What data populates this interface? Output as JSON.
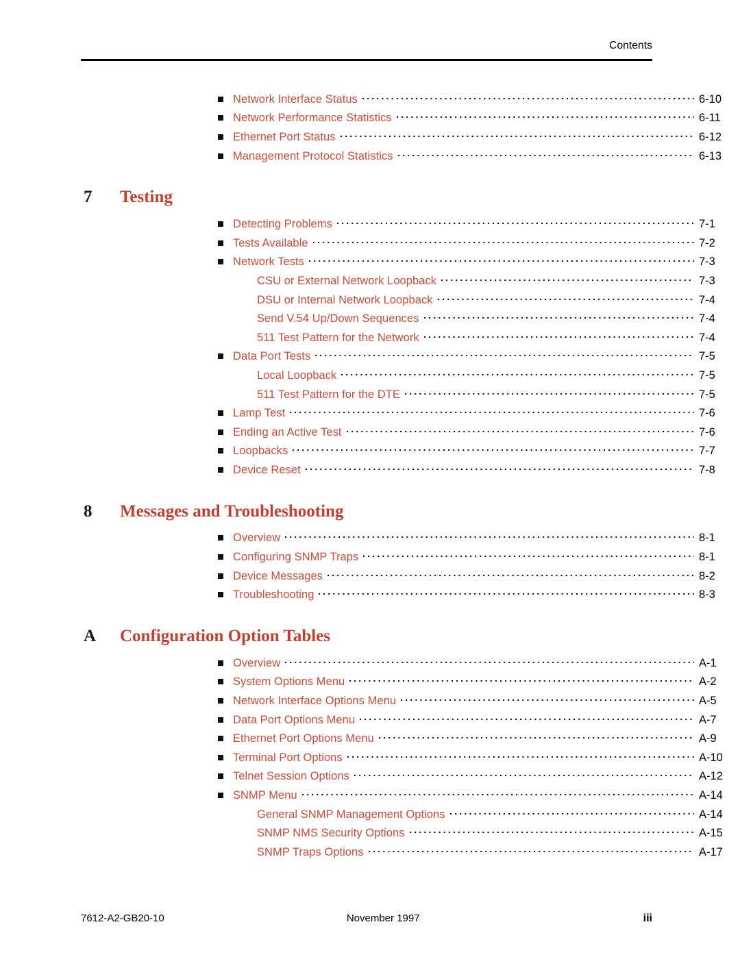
{
  "header": {
    "label": "Contents"
  },
  "toc": {
    "groups": [
      {
        "heading": null,
        "entries": [
          {
            "level": 1,
            "title": "Network Interface Status",
            "page": "6-10"
          },
          {
            "level": 1,
            "title": "Network Performance Statistics",
            "page": "6-11"
          },
          {
            "level": 1,
            "title": "Ethernet Port Status",
            "page": "6-12"
          },
          {
            "level": 1,
            "title": "Management Protocol Statistics",
            "page": "6-13"
          }
        ]
      },
      {
        "heading": {
          "number": "7",
          "title": "Testing"
        },
        "entries": [
          {
            "level": 1,
            "title": "Detecting Problems",
            "page": "7-1"
          },
          {
            "level": 1,
            "title": "Tests Available",
            "page": "7-2"
          },
          {
            "level": 1,
            "title": "Network Tests",
            "page": "7-3"
          },
          {
            "level": 2,
            "title": "CSU or External Network Loopback",
            "page": "7-3"
          },
          {
            "level": 2,
            "title": "DSU or Internal Network Loopback",
            "page": "7-4"
          },
          {
            "level": 2,
            "title": "Send V.54 Up/Down Sequences",
            "page": "7-4"
          },
          {
            "level": 2,
            "title": "511 Test Pattern for the Network",
            "page": "7-4"
          },
          {
            "level": 1,
            "title": "Data Port Tests",
            "page": "7-5"
          },
          {
            "level": 2,
            "title": "Local Loopback",
            "page": "7-5"
          },
          {
            "level": 2,
            "title": "511 Test Pattern for the DTE",
            "page": "7-5"
          },
          {
            "level": 1,
            "title": "Lamp Test",
            "page": "7-6"
          },
          {
            "level": 1,
            "title": "Ending an Active Test",
            "page": "7-6"
          },
          {
            "level": 1,
            "title": "Loopbacks",
            "page": "7-7"
          },
          {
            "level": 1,
            "title": "Device Reset",
            "page": "7-8"
          }
        ]
      },
      {
        "heading": {
          "number": "8",
          "title": "Messages and Troubleshooting"
        },
        "entries": [
          {
            "level": 1,
            "title": "Overview",
            "page": "8-1"
          },
          {
            "level": 1,
            "title": "Configuring SNMP Traps",
            "page": "8-1"
          },
          {
            "level": 1,
            "title": "Device Messages",
            "page": "8-2"
          },
          {
            "level": 1,
            "title": "Troubleshooting",
            "page": "8-3"
          }
        ]
      },
      {
        "heading": {
          "number": "A",
          "title": "Configuration Option Tables"
        },
        "entries": [
          {
            "level": 1,
            "title": "Overview",
            "page": "A-1"
          },
          {
            "level": 1,
            "title": "System Options Menu",
            "page": "A-2"
          },
          {
            "level": 1,
            "title": "Network Interface Options Menu",
            "page": "A-5"
          },
          {
            "level": 1,
            "title": "Data Port Options Menu",
            "page": "A-7"
          },
          {
            "level": 1,
            "title": "Ethernet Port Options Menu",
            "page": "A-9"
          },
          {
            "level": 1,
            "title": "Terminal Port Options",
            "page": "A-10"
          },
          {
            "level": 1,
            "title": "Telnet Session Options",
            "page": "A-12"
          },
          {
            "level": 1,
            "title": "SNMP Menu",
            "page": "A-14"
          },
          {
            "level": 2,
            "title": "General SNMP Management Options",
            "page": "A-14"
          },
          {
            "level": 2,
            "title": "SNMP NMS Security Options",
            "page": "A-15"
          },
          {
            "level": 2,
            "title": "SNMP Traps Options",
            "page": "A-17"
          }
        ]
      }
    ]
  },
  "footer": {
    "document_number": "7612-A2-GB20-10",
    "date": "November 1997",
    "page_number": "iii"
  },
  "colors": {
    "entry_text": "#cc4b38",
    "heading_text": "#c1402f",
    "page_number": "#000000",
    "rule": "#000000"
  }
}
